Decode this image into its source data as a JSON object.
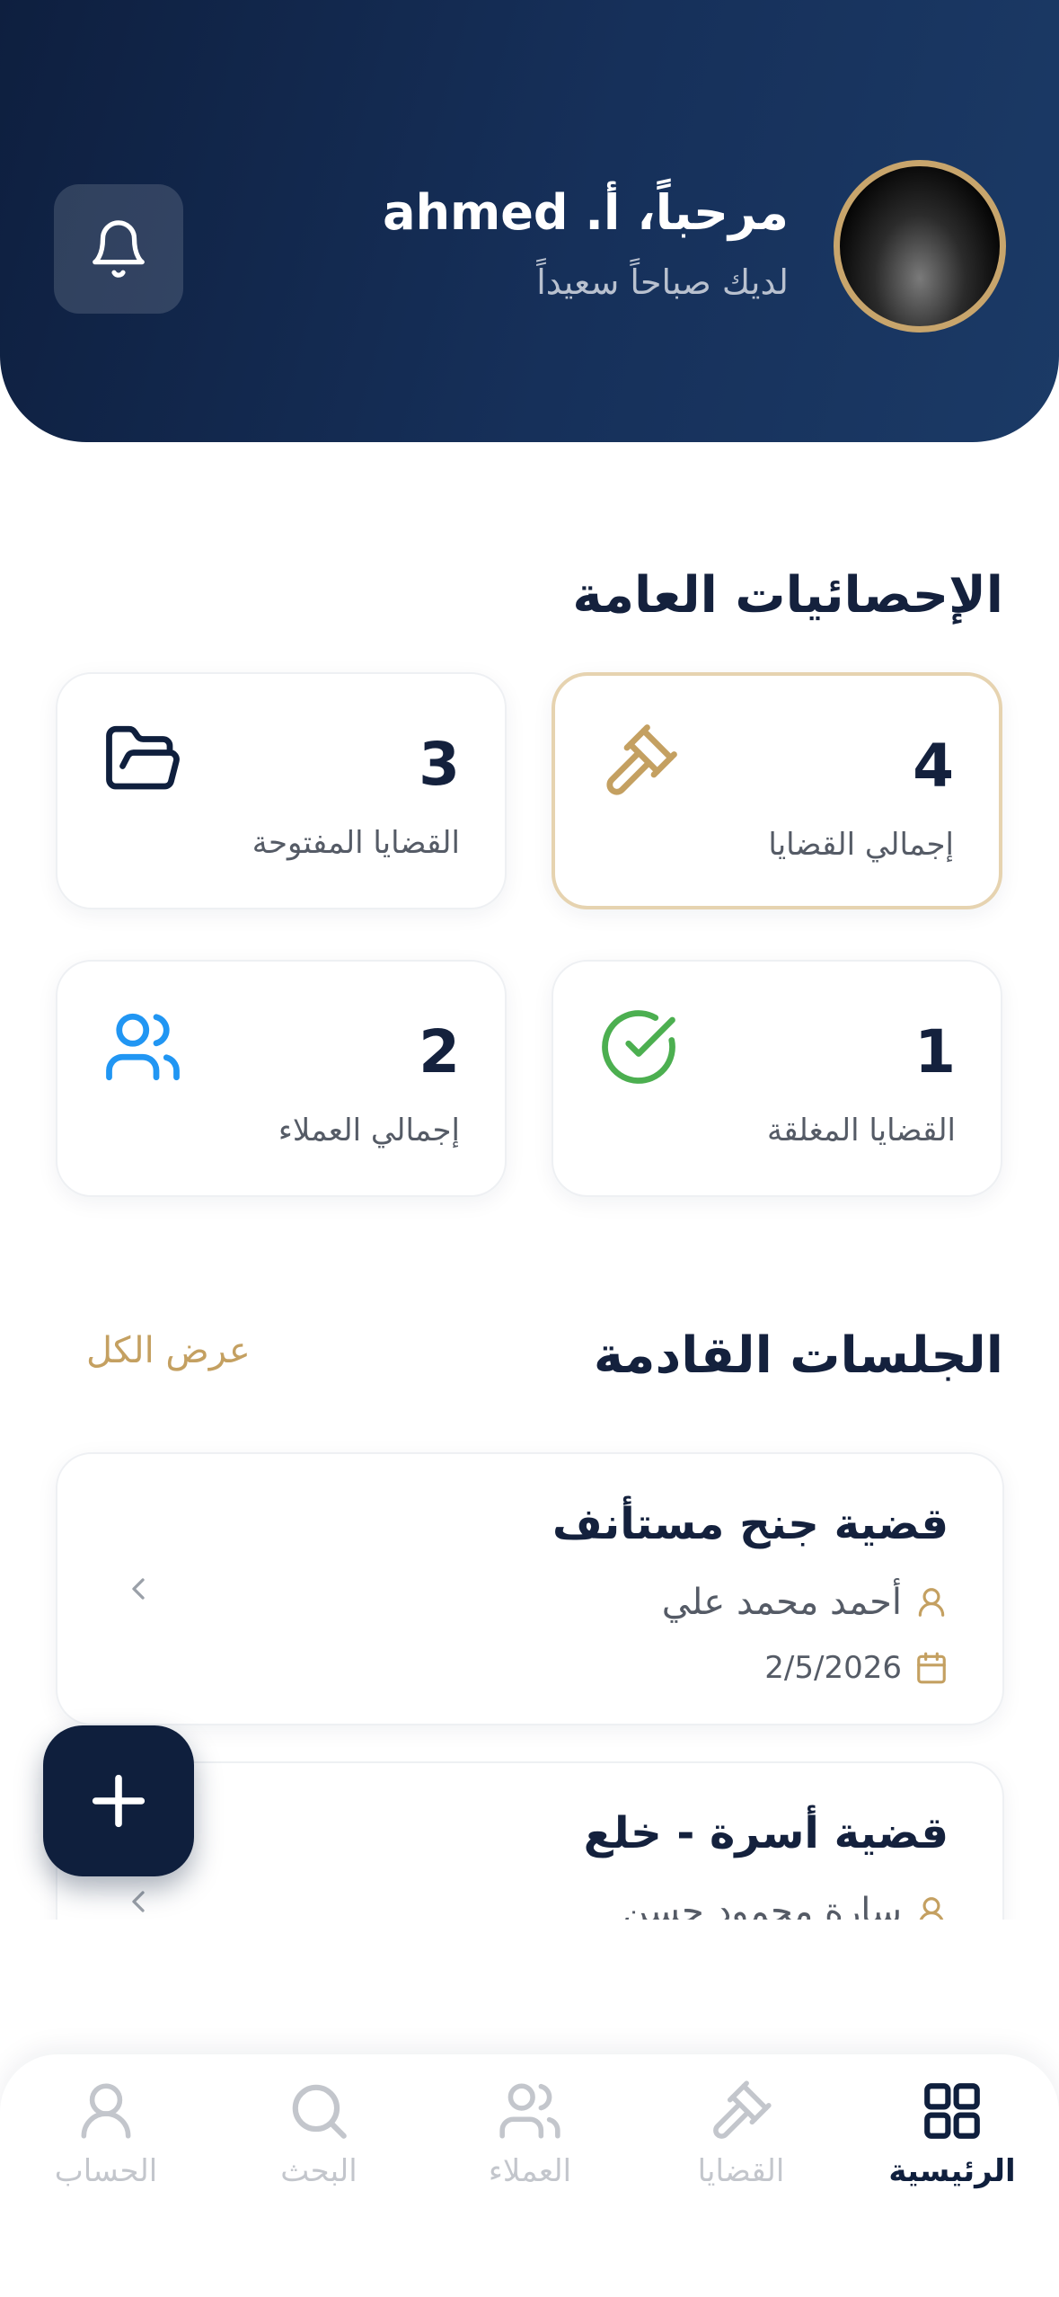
{
  "header": {
    "greeting": "مرحباً، أ. ahmed",
    "subtitle": "لديك صباحاً سعيداً"
  },
  "stats": {
    "title": "الإحصائيات العامة",
    "cards": [
      {
        "value": "4",
        "label": "إجمالي القضايا",
        "icon": "gavel-icon"
      },
      {
        "value": "3",
        "label": "القضايا المفتوحة",
        "icon": "folder-open-icon"
      },
      {
        "value": "1",
        "label": "القضايا المغلقة",
        "icon": "check-circle-icon"
      },
      {
        "value": "2",
        "label": "إجمالي العملاء",
        "icon": "users-icon"
      }
    ]
  },
  "sessions": {
    "title": "الجلسات القادمة",
    "view_all": "عرض الكل",
    "items": [
      {
        "title": "قضية جنح مستأنف",
        "client": "أحمد محمد علي",
        "date": "2/5/2026"
      },
      {
        "title": "قضية أسرة - خلع",
        "client": "سارة محمود حسن",
        "date": ""
      }
    ]
  },
  "nav": {
    "items": [
      {
        "label": "الرئيسية",
        "icon": "grid-icon",
        "active": true
      },
      {
        "label": "القضايا",
        "icon": "gavel-icon",
        "active": false
      },
      {
        "label": "العملاء",
        "icon": "users-icon",
        "active": false
      },
      {
        "label": "البحث",
        "icon": "search-icon",
        "active": false
      },
      {
        "label": "الحساب",
        "icon": "user-icon",
        "active": false
      }
    ]
  },
  "colors": {
    "navy": "#0f1f3d",
    "gold": "#c4a061",
    "green": "#4caf50",
    "blue": "#2196f3"
  }
}
